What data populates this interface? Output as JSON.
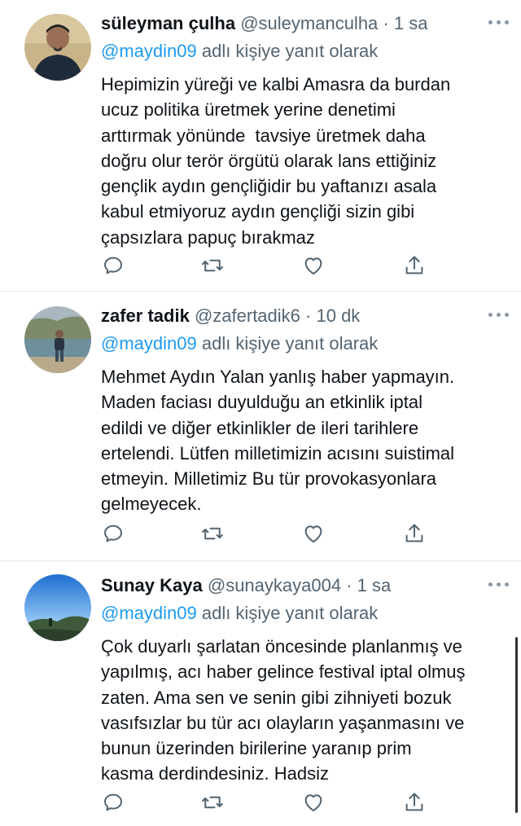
{
  "tweets": [
    {
      "name": "süleyman çulha",
      "handle": "@suleymanculha",
      "separator": "·",
      "time": "1 sa",
      "reply_mention": "@maydin09",
      "reply_suffix": " adlı kişiye yanıt olarak",
      "text": "Hepimizin yüreği ve kalbi Amasra da burdan\nucuz politika üretmek yerine denetimi\narttırmak yönünde  tavsiye üretmek daha\ndoğru olur terör örgütü olarak lans ettiğiniz\ngençlik aydın gençliğidir bu yaftanızı asala\nkabul etmiyoruz aydın gençliği sizin gibi\nçapsızlara papuç bırakmaz",
      "avatar_icon": "person-dark-shirt-avatar"
    },
    {
      "name": "zafer tadik",
      "handle": "@zafertadik6",
      "separator": "·",
      "time": "10 dk",
      "reply_mention": "@maydin09",
      "reply_suffix": " adlı kişiye yanıt olarak",
      "text": "Mehmet Aydın Yalan yanlış haber yapmayın.\nMaden faciası duyulduğu an etkinlik iptal\nedildi ve diğer etkinlikler de ileri tarihlere\nertelendi. Lütfen milletimizin acısını suistimal\netmeyin. Milletimiz Bu tür provokasyonlara\ngelmeyecek.",
      "avatar_icon": "person-by-lake-avatar"
    },
    {
      "name": "Sunay Kaya",
      "handle": "@sunaykaya004",
      "separator": "·",
      "time": "1 sa",
      "reply_mention": "@maydin09",
      "reply_suffix": " adlı kişiye yanıt olarak",
      "text": "Çok duyarlı şarlatan öncesinde planlanmış ve\nyapılmış, acı haber gelince festival iptal olmuş\nzaten. Ama sen ve senin gibi zihniyeti bozuk\nvasıfsızlar bu tür acı olayların yaşanmasını ve\nbunun üzerinden birilerine yaranıp prim\nkasma derdindesiniz. Hadsiz",
      "avatar_icon": "landscape-sky-avatar"
    }
  ],
  "action_icons": [
    "reply-icon",
    "retweet-icon",
    "like-icon",
    "share-icon"
  ],
  "colors": {
    "mention": "#1d9bf0",
    "secondary_text": "#536471",
    "primary_text": "#0f1419",
    "divider": "#e6ecf0"
  }
}
